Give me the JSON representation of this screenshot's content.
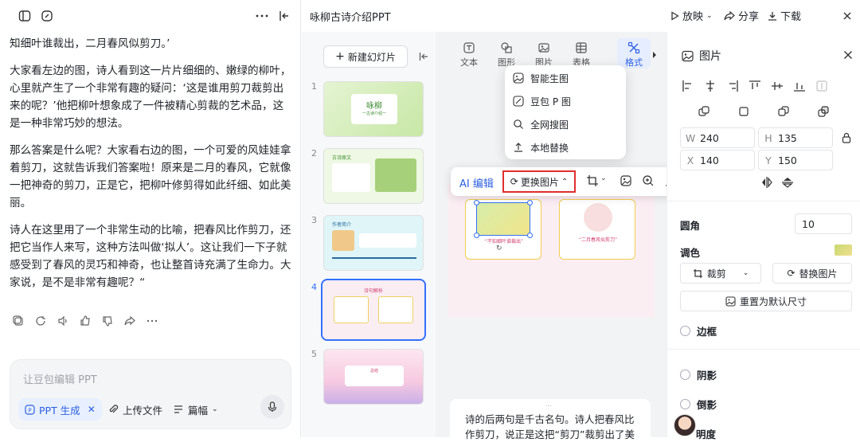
{
  "chat": {
    "messages": [
      "知细叶谁裁出，二月春风似剪刀。’",
      "大家看左边的图，诗人看到这一片片细细的、嫩绿的柳叶，心里就产生了一个非常有趣的疑问：‘这是谁用剪刀裁剪出来的呢？’他把柳叶想象成了一件被精心剪裁的艺术品，这是一种非常巧妙的想法。",
      "那么答案是什么呢？大家看右边的图，一个可爱的风娃娃拿着剪刀，这就告诉我们答案啦！原来是二月的春风，它就像一把神奇的剪刀，正是它，把柳叶修剪得如此纤细、如此美丽。",
      "诗人在这里用了一个非常生动的比喻，把春风比作剪刀，还把它当作人来写，这种方法叫做‘拟人’。这让我们一下子就感受到了春风的灵巧和神奇，也让整首诗充满了生命力。大家说，是不是非常有趣呢？“"
    ],
    "placeholder": "让豆包编辑 PPT",
    "ppt_chip": "PPT 生成",
    "upload": "上传文件",
    "length": "篇幅"
  },
  "header": {
    "doc_title": "咏柳古诗介绍PPT",
    "play": "放映",
    "share": "分享",
    "download": "下载"
  },
  "thumbs": {
    "new_slide": "新建幻灯片",
    "slides": [
      {
        "num": "1",
        "title": "咏柳",
        "sub": "一古诗介绍一"
      },
      {
        "num": "2",
        "title": "古诗原文"
      },
      {
        "num": "3",
        "title": "作者简介"
      },
      {
        "num": "4",
        "title": "诗句解析"
      },
      {
        "num": "5",
        "title": "总结"
      }
    ]
  },
  "toolbar": {
    "tabs": [
      "文本",
      "图形",
      "图片",
      "表格",
      "格式"
    ]
  },
  "dropdown": {
    "items": [
      "智能生图",
      "豆包 P 图",
      "全网搜图",
      "本地替换"
    ]
  },
  "floating": {
    "ai_edit": "AI 编辑",
    "replace": "更换图片"
  },
  "slide": {
    "left_caption": "“不知细叶谁裁出”",
    "right_caption": "“二月春风似剪刀”"
  },
  "notes": {
    "text": "诗的后两句是千古名句。诗人把春风比作剪刀，说正是这把“剪刀”裁剪出了美"
  },
  "props": {
    "title": "图片",
    "w_label": "W",
    "w": "240",
    "h_label": "H",
    "h": "135",
    "x_label": "X",
    "x": "140",
    "y_label": "Y",
    "y": "150",
    "radius_label": "圆角",
    "radius": "10",
    "color_label": "调色",
    "crop": "裁剪",
    "replace": "替换图片",
    "reset": "重置为默认尺寸",
    "border": "边框",
    "shadow": "阴影",
    "reflection": "倒影",
    "brightness": "明度"
  },
  "colors": {
    "accent": "#2c5fdf",
    "highlight": "#e02e2e",
    "selected": "#3370ff"
  }
}
